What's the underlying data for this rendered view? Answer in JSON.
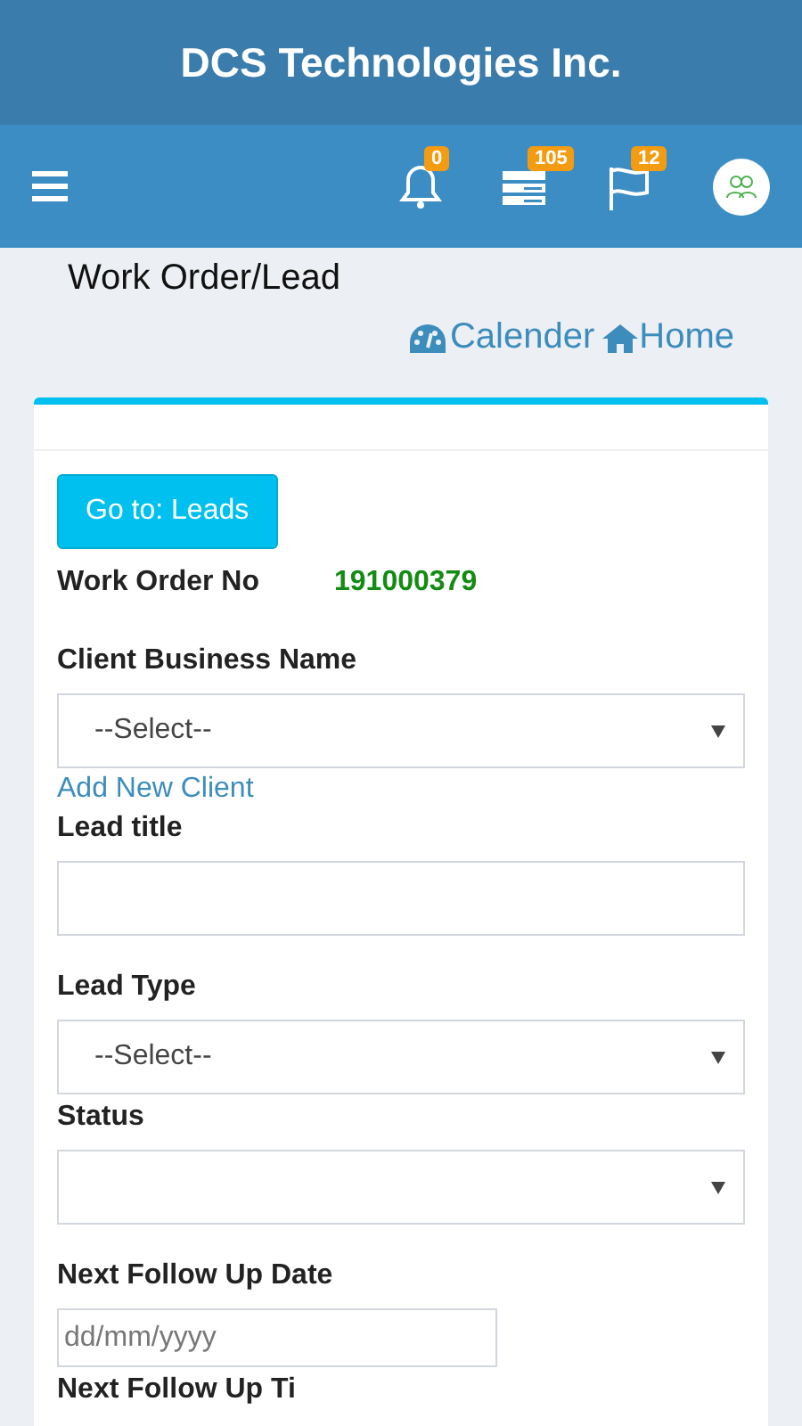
{
  "app_title": "DCS Technologies Inc.",
  "toolbar": {
    "badges": [
      {
        "kind": "bell",
        "count": "0"
      },
      {
        "kind": "tasks",
        "count": "105"
      },
      {
        "kind": "flag",
        "count": "12"
      }
    ]
  },
  "page_title": "Work Order/Lead",
  "links": [
    {
      "kind": "calendar",
      "label": "Calender"
    },
    {
      "kind": "home",
      "label": "Home"
    }
  ],
  "form": {
    "go_button": "Go to: Leads",
    "work_order": {
      "label": "Work Order No",
      "value": "191000379"
    },
    "fields": [
      {
        "kind": "select",
        "label": "Client Business Name",
        "value": "--Select--",
        "link": "Add New Client"
      },
      {
        "kind": "text",
        "label": "Lead title"
      },
      {
        "kind": "select",
        "label": "Lead Type",
        "value": "--Select--"
      },
      {
        "kind": "select",
        "label": "Status"
      },
      {
        "kind": "date",
        "label": "Next Follow Up Date",
        "placeholder": "dd/mm/yyyy"
      },
      {
        "kind": "label",
        "label": "Next Follow Up Ti"
      }
    ]
  }
}
